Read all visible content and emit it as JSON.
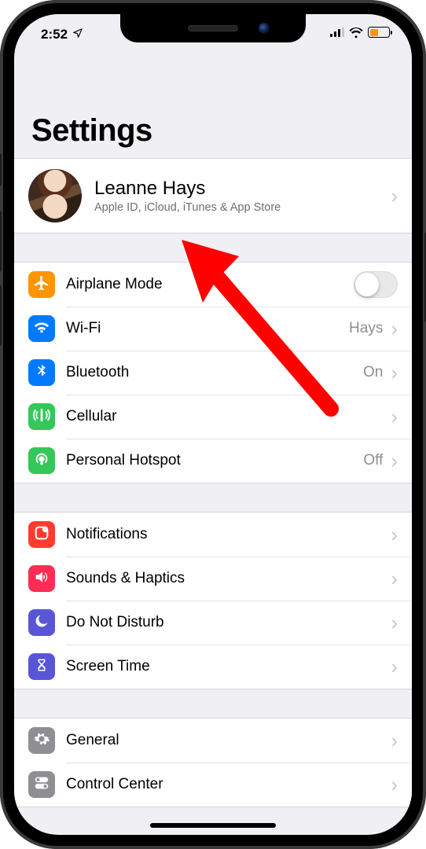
{
  "status": {
    "time": "2:52",
    "location_icon": "location-arrow",
    "battery_state": "low-power"
  },
  "page": {
    "title": "Settings"
  },
  "account": {
    "name": "Leanne Hays",
    "subtitle": "Apple ID, iCloud, iTunes & App Store"
  },
  "groups": [
    {
      "id": "connectivity",
      "rows": [
        {
          "id": "airplane",
          "icon": "airplane-icon",
          "icon_color": "ic-orange",
          "label": "Airplane Mode",
          "control": "toggle",
          "toggle_on": false
        },
        {
          "id": "wifi",
          "icon": "wifi-icon",
          "icon_color": "ic-blue",
          "label": "Wi-Fi",
          "value": "Hays",
          "chevron": true
        },
        {
          "id": "bt",
          "icon": "bluetooth-icon",
          "icon_color": "ic-btblue",
          "label": "Bluetooth",
          "value": "On",
          "chevron": true
        },
        {
          "id": "cell",
          "icon": "cellular-icon",
          "icon_color": "ic-green",
          "label": "Cellular",
          "chevron": true
        },
        {
          "id": "hotspot",
          "icon": "hotspot-icon",
          "icon_color": "ic-green2",
          "label": "Personal Hotspot",
          "value": "Off",
          "chevron": true
        }
      ]
    },
    {
      "id": "notifications",
      "rows": [
        {
          "id": "notif",
          "icon": "notifications-icon",
          "icon_color": "ic-red",
          "label": "Notifications",
          "chevron": true
        },
        {
          "id": "sounds",
          "icon": "sounds-icon",
          "icon_color": "ic-pink",
          "label": "Sounds & Haptics",
          "chevron": true
        },
        {
          "id": "dnd",
          "icon": "moon-icon",
          "icon_color": "ic-indigo",
          "label": "Do Not Disturb",
          "chevron": true
        },
        {
          "id": "st",
          "icon": "hourglass-icon",
          "icon_color": "ic-violet",
          "label": "Screen Time",
          "chevron": true
        }
      ]
    },
    {
      "id": "general",
      "rows": [
        {
          "id": "general",
          "icon": "gear-icon",
          "icon_color": "ic-gray",
          "label": "General",
          "chevron": true
        },
        {
          "id": "cc",
          "icon": "control-center-icon",
          "icon_color": "ic-gray",
          "label": "Control Center",
          "chevron": true
        }
      ]
    }
  ],
  "annotation": {
    "type": "arrow",
    "color": "#ff0000",
    "points_to": "account-row"
  }
}
